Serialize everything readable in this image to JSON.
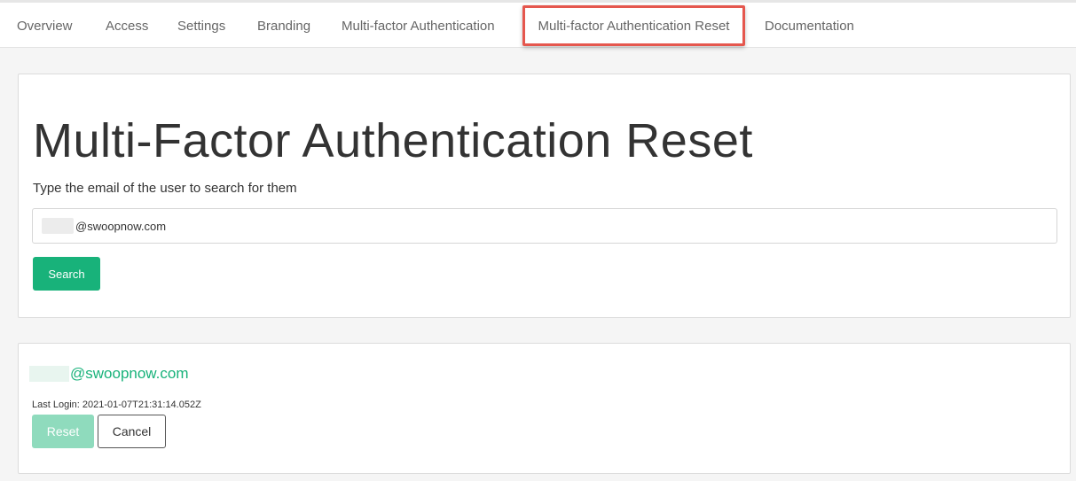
{
  "tabs": [
    {
      "label": "Overview"
    },
    {
      "label": "Access"
    },
    {
      "label": "Settings"
    },
    {
      "label": "Branding"
    },
    {
      "label": "Multi-factor Authentication"
    },
    {
      "label": "Multi-factor Authentication Reset",
      "active": true
    },
    {
      "label": "Documentation"
    }
  ],
  "search": {
    "title": "Multi-Factor Authentication Reset",
    "prompt": "Type the email of the user to search for them",
    "input_value": "@swoopnow.com",
    "button_label": "Search"
  },
  "result": {
    "email": "@swoopnow.com",
    "last_login": "Last Login: 2021-01-07T21:31:14.052Z",
    "reset_label": "Reset",
    "cancel_label": "Cancel"
  },
  "colors": {
    "accent": "#18b27a",
    "accent_disabled": "#8fdbbd",
    "highlight_border": "#e5574e"
  }
}
